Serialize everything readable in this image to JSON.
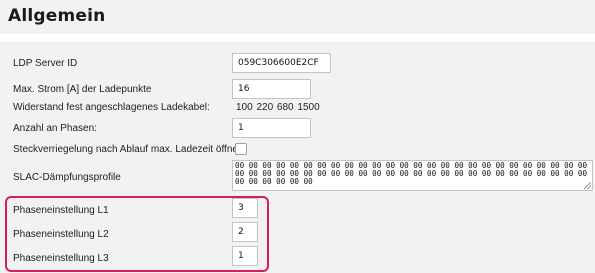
{
  "section": {
    "title": "Allgemein"
  },
  "fields": {
    "ldp_server_id": {
      "label": "LDP Server ID",
      "value": "059C306600E2CF"
    },
    "max_strom": {
      "label": "Max. Strom [A] der Ladepunkte",
      "value": "16"
    },
    "widerstand": {
      "label": "Widerstand fest angeschlagenes Ladekabel:",
      "value": "100  220  680  1500"
    },
    "anzahl_phasen": {
      "label": "Anzahl an Phasen:",
      "value": "1"
    },
    "steckverriegelung": {
      "label": "Steckverriegelung nach Ablauf max. Ladezeit öffnen",
      "checked": false
    },
    "slac": {
      "label": "SLAC-Dämpfungsprofile",
      "value": "00 00 00 00 00 00 00 00 00 00 00 00 00 00 00 00 00 00 00 00 00 00 00 00 00 00 00 00 00 00 00 00 00 00 00 00 00 00 00 00 00 00 00 00 00 00 00 00 00 00 00 00 00 00 00 00 00 00"
    },
    "phase_l1": {
      "label": "Phaseneinstellung L1",
      "value": "3"
    },
    "phase_l2": {
      "label": "Phaseneinstellung L2",
      "value": "2"
    },
    "phase_l3": {
      "label": "Phaseneinstellung L3",
      "value": "1"
    }
  },
  "colors": {
    "panel_background": "#f2f2f2",
    "highlight_border": "#d21f63",
    "input_border": "#c4c4c4"
  }
}
